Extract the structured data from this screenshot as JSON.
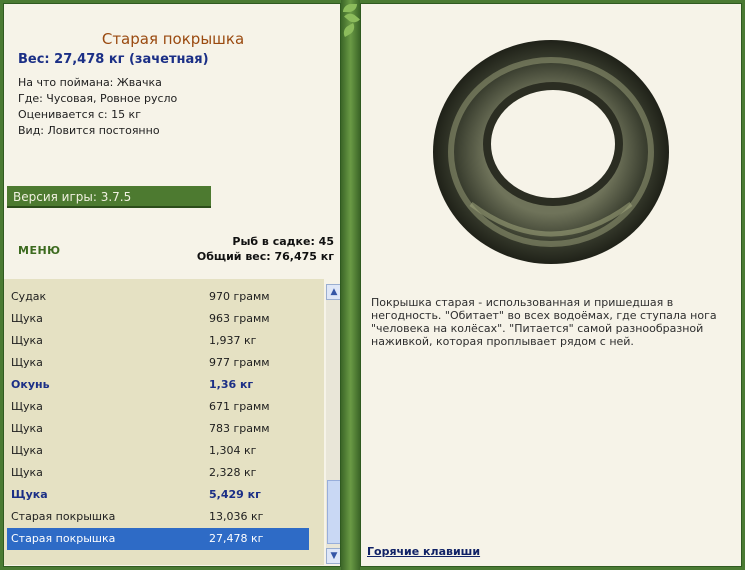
{
  "fish": {
    "title": "Старая покрышка",
    "weight": "Вес: 27,478 кг (зачетная)",
    "caught_on": "На что поймана: Жвачка",
    "where": "Где: Чусовая, Ровное русло",
    "valued_from": "Оценивается с: 15 кг",
    "kind": "Вид: Ловится постоянно"
  },
  "version": "Версия игры: 3.7.5",
  "menu_label": "МЕНЮ",
  "stats": {
    "fish_count": "Рыб в садке: 45",
    "total_weight": "Общий вес: 76,475 кг"
  },
  "catch_list": [
    {
      "name": "Судак",
      "weight": "970 грамм",
      "style": "normal"
    },
    {
      "name": "Щука",
      "weight": "963 грамм",
      "style": "normal"
    },
    {
      "name": "Щука",
      "weight": "1,937 кг",
      "style": "normal"
    },
    {
      "name": "Щука",
      "weight": "977 грамм",
      "style": "normal"
    },
    {
      "name": "Окунь",
      "weight": "1,36 кг",
      "style": "bold"
    },
    {
      "name": "Щука",
      "weight": "671 грамм",
      "style": "normal"
    },
    {
      "name": "Щука",
      "weight": "783 грамм",
      "style": "normal"
    },
    {
      "name": "Щука",
      "weight": "1,304 кг",
      "style": "normal"
    },
    {
      "name": "Щука",
      "weight": "2,328 кг",
      "style": "normal"
    },
    {
      "name": "Щука",
      "weight": "5,429 кг",
      "style": "bold"
    },
    {
      "name": "Старая покрышка",
      "weight": "13,036 кг",
      "style": "normal"
    },
    {
      "name": "Старая покрышка",
      "weight": "27,478 кг",
      "style": "selected"
    }
  ],
  "description": "Покрышка старая - использованная и пришедшая в негодность. \"Обитает\" во всех водоёмах, где ступала нога \"человека на колёсах\". \"Питается\" самой разнообразной наживкой, которая проплывает рядом с ней.",
  "hotkeys_label": "Горячие клавиши",
  "icons": {
    "scroll_up": "scroll-up-arrow-icon",
    "scroll_down": "scroll-down-arrow-icon",
    "item_image": "old-tyre-image"
  },
  "colors": {
    "panel_bg": "#f6f3e8",
    "frame_green": "#4a7a33",
    "title_brown": "#9a4a10",
    "accent_blue": "#1b2f86",
    "selection_blue": "#2e6bc6"
  }
}
